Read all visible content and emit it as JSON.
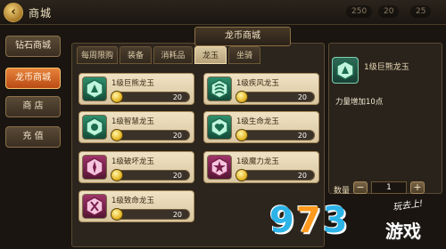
{
  "header": {
    "title": "商城",
    "resources": [
      "250",
      "20",
      "25"
    ]
  },
  "sidebar": {
    "items": [
      {
        "label": "钻石商城"
      },
      {
        "label": "龙币商城"
      },
      {
        "label": "商 店"
      },
      {
        "label": "充 值"
      }
    ]
  },
  "panel": {
    "title": "龙币商城",
    "tabs": [
      {
        "label": "每周限购"
      },
      {
        "label": "装备"
      },
      {
        "label": "消耗品"
      },
      {
        "label": "龙玉"
      },
      {
        "label": "坐骑"
      }
    ]
  },
  "items": [
    {
      "name": "1级巨熊龙玉",
      "price": "20",
      "icon": "bear-jade-icon",
      "color": "#2f8f6c"
    },
    {
      "name": "1级疾风龙玉",
      "price": "20",
      "icon": "wind-jade-icon",
      "color": "#2f8f6c"
    },
    {
      "name": "1级智慧龙玉",
      "price": "20",
      "icon": "wisdom-jade-icon",
      "color": "#2f8f6c"
    },
    {
      "name": "1级生命龙玉",
      "price": "20",
      "icon": "life-jade-icon",
      "color": "#2f8f6c"
    },
    {
      "name": "1级破坏龙玉",
      "price": "20",
      "icon": "destroy-jade-icon",
      "color": "#a0356a"
    },
    {
      "name": "1级魔力龙玉",
      "price": "20",
      "icon": "magic-jade-icon",
      "color": "#a0356a"
    },
    {
      "name": "1级致命龙玉",
      "price": "20",
      "icon": "lethal-jade-icon",
      "color": "#a0356a"
    }
  ],
  "detail": {
    "name": "1级巨熊龙玉",
    "description": "力量增加10点",
    "quantity_label": "数量",
    "quantity": "1",
    "minus": "−",
    "plus": "+"
  },
  "watermark": {
    "digits_a": "9",
    "digits_b": "7",
    "digits_c": "3",
    "slogan": "玩去上!",
    "brand": "游戏"
  }
}
